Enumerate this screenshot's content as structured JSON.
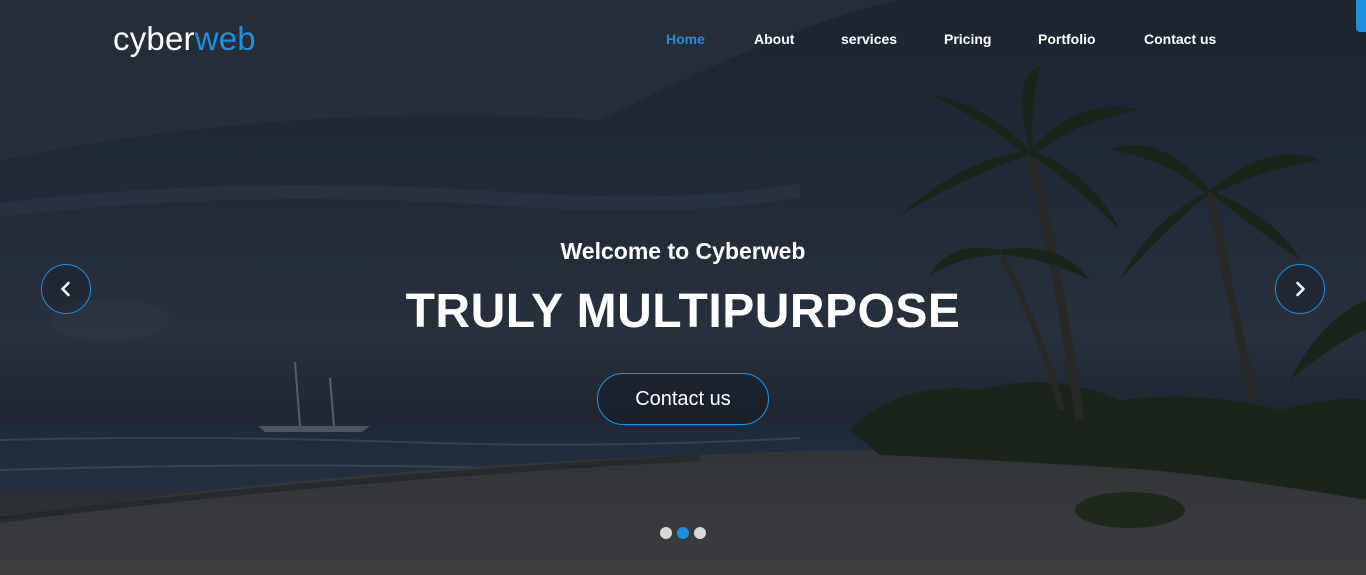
{
  "header": {
    "logo_part1": "cyber",
    "logo_part2": "web",
    "nav": [
      {
        "label": "Home",
        "active": true
      },
      {
        "label": "About",
        "active": false
      },
      {
        "label": "services",
        "active": false
      },
      {
        "label": "Pricing",
        "active": false
      },
      {
        "label": "Portfolio",
        "active": false
      },
      {
        "label": "Contact us",
        "active": false
      }
    ]
  },
  "slider": {
    "subtitle": "Welcome to Cyberweb",
    "headline": "TRULY MULTIPURPOSE",
    "cta_label": "Contact us",
    "prev_icon": "chevron-left-icon",
    "next_icon": "chevron-right-icon",
    "slide_count": 3,
    "active_slide": 2
  },
  "colors": {
    "accent": "#1e90e0",
    "text": "#ffffff",
    "dot_inactive": "#d8d8d8"
  }
}
